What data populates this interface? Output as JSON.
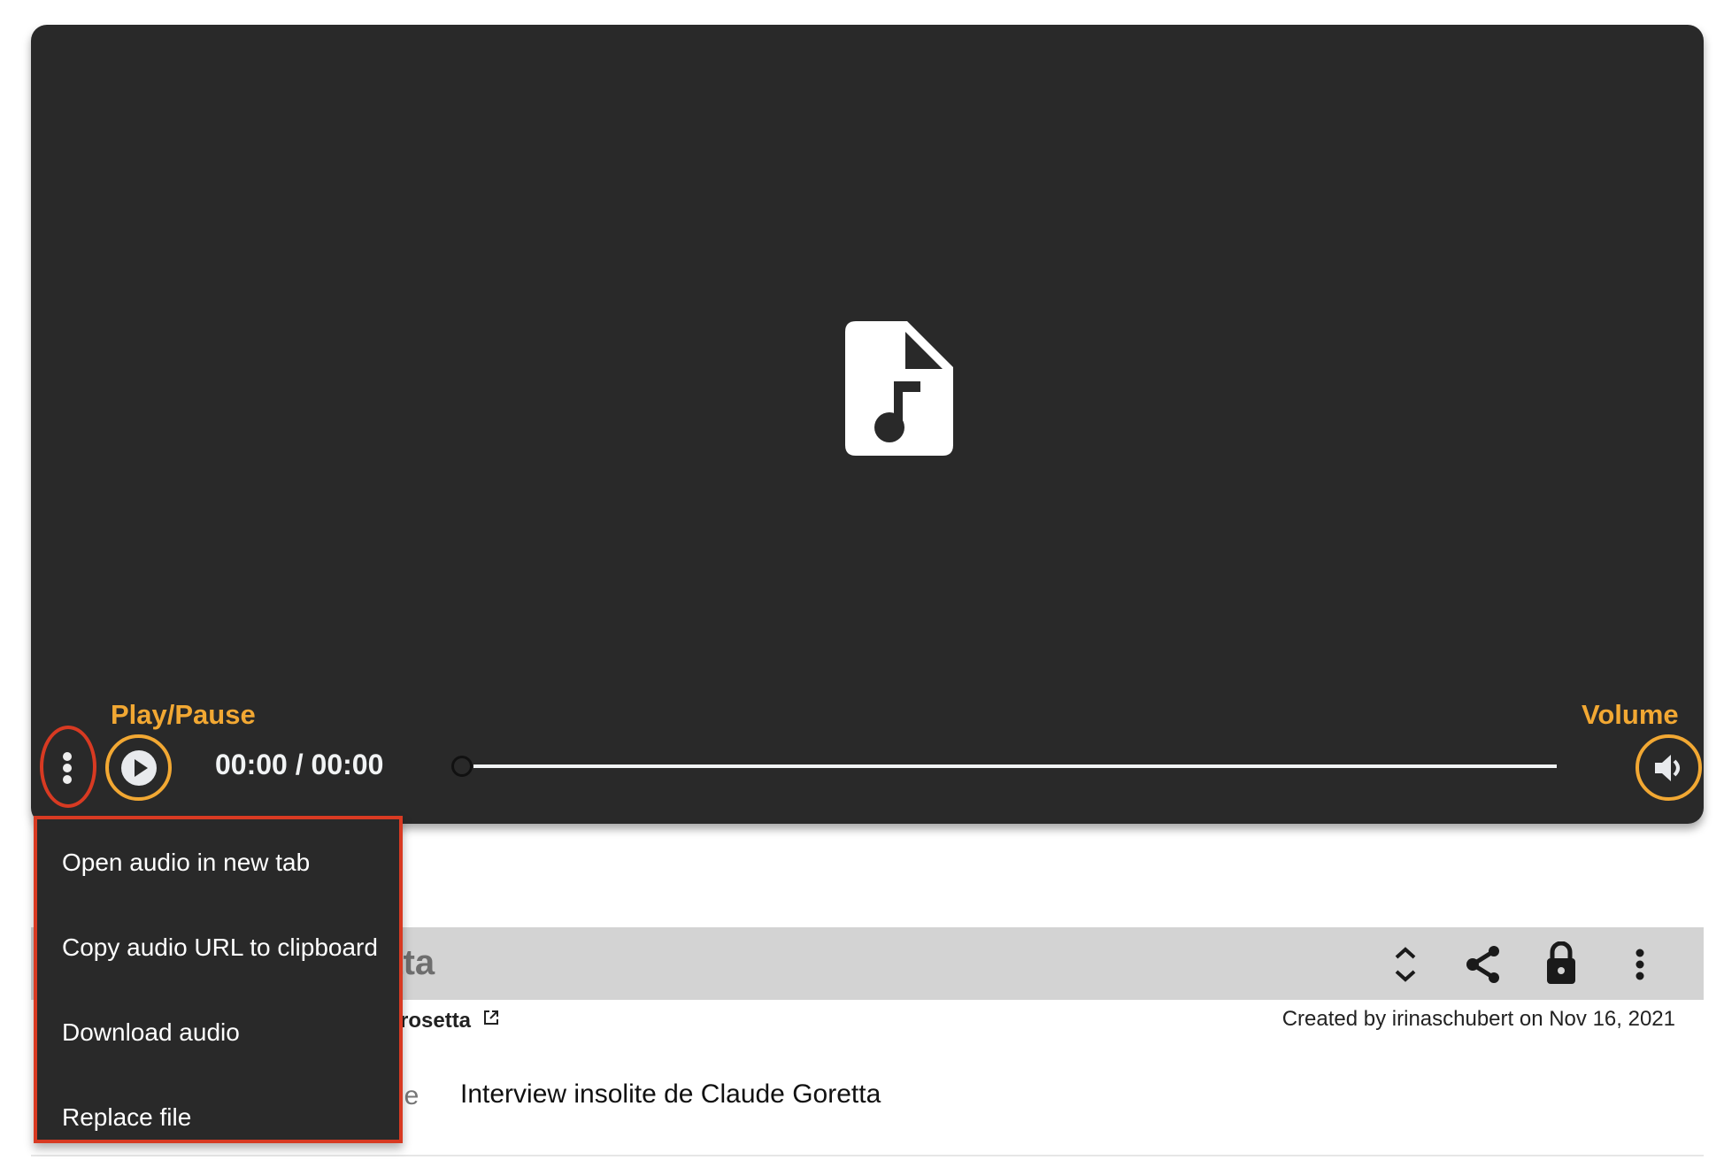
{
  "player": {
    "time_display": "00:00 / 00:00",
    "progress_fraction": 0,
    "play_annotation": "Play/Pause",
    "volume_annotation": "Volume",
    "annotation_color": "#f2a833",
    "highlight_color": "#d83a22"
  },
  "menu": {
    "items": [
      {
        "label": "Open audio in new tab"
      },
      {
        "label": "Copy audio URL to clipboard"
      },
      {
        "label": "Download audio"
      },
      {
        "label": "Replace file"
      }
    ]
  },
  "record": {
    "title_fragment": "etta",
    "owner_fragment": "rosetta",
    "created": "Created by irinaschubert on Nov 16, 2021",
    "field_label_fragment": "le",
    "field_value": "Interview insolite de Claude Goretta"
  }
}
